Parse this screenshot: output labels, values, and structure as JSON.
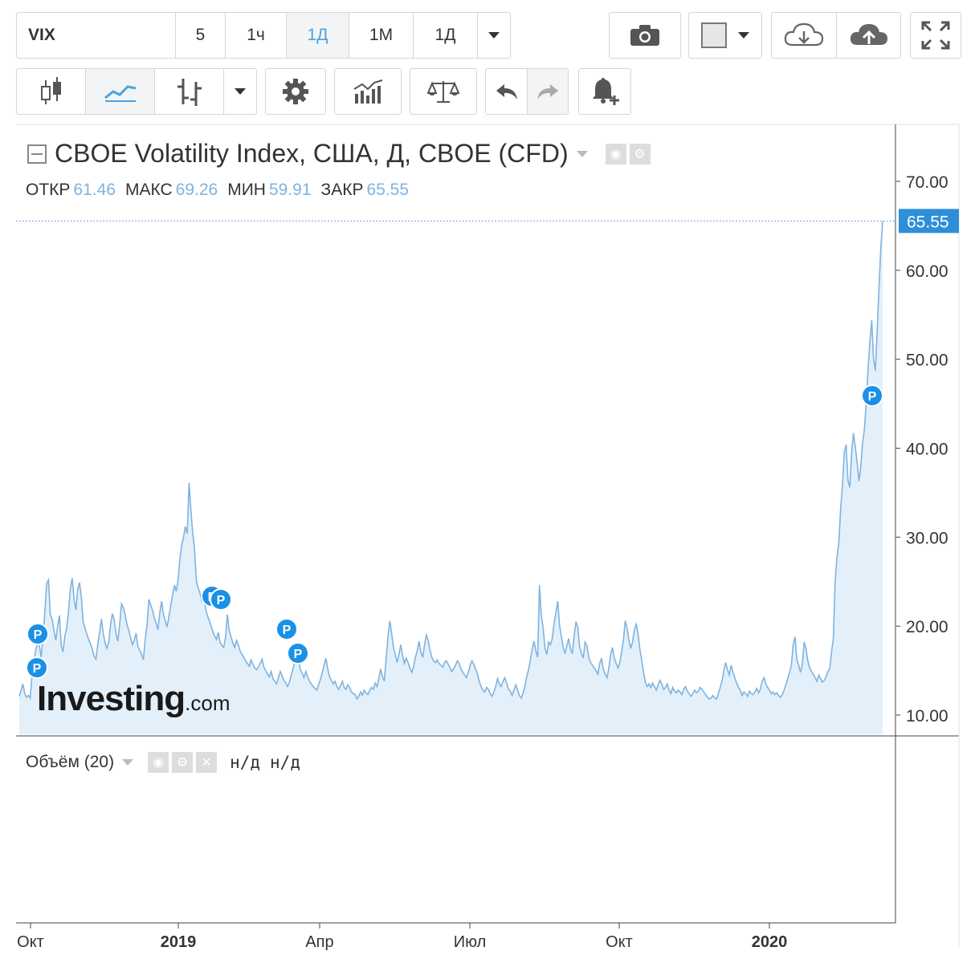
{
  "toolbar1": {
    "symbol": "VIX",
    "intervals": [
      "5",
      "1ч",
      "1Д",
      "1М",
      "1Д"
    ],
    "active_interval": "1Д"
  },
  "chart_header": {
    "title": "CBOE Volatility Index, США, Д, CBOE (CFD)",
    "open_label": "ОТКР",
    "open": "61.46",
    "high_label": "МАКС",
    "high": "69.26",
    "low_label": "МИН",
    "low": "59.91",
    "close_label": "ЗАКР",
    "close": "65.55"
  },
  "volume_panel": {
    "label": "Объём (20)",
    "value1": "н/д",
    "value2": "н/д"
  },
  "watermark": {
    "brand": "Investing",
    "suffix": ".com"
  },
  "colors": {
    "line": "#7fb3e0",
    "fill": "#e3f0fa",
    "accent": "#4aa3df",
    "price_tag": "#2e8fd9",
    "event": "#1a90e6"
  },
  "chart_data": {
    "type": "area",
    "title": "CBOE Volatility Index, США, Д, CBOE (CFD)",
    "y_ticks": [
      "10.00",
      "20.00",
      "30.00",
      "40.00",
      "50.00",
      "60.00",
      "70.00"
    ],
    "ylim": [
      8,
      75
    ],
    "x_ticks": [
      "Окт",
      "2019",
      "Апр",
      "Июл",
      "Окт",
      "2020"
    ],
    "last_price_label": "65.55",
    "last_value": 65.55,
    "event_marker_label": "P",
    "series": [
      {
        "values": [
          12.1,
          12.8,
          13.5,
          12.4,
          12.0,
          12.2,
          11.9,
          14.5,
          16.1,
          17.3,
          18.2,
          17.8,
          16.5,
          18.6,
          21.5,
          24.8,
          25.2,
          21.3,
          20.8,
          19.5,
          18.4,
          19.9,
          21.2,
          17.8,
          17.1,
          18.9,
          19.8,
          21.7,
          24.2,
          25.4,
          23.0,
          21.8,
          24.1,
          24.9,
          23.2,
          20.5,
          19.8,
          19.1,
          18.5,
          18.0,
          17.4,
          16.6,
          16.3,
          17.9,
          19.3,
          20.8,
          19.2,
          18.1,
          17.5,
          18.2,
          20.1,
          21.4,
          20.7,
          19.1,
          18.3,
          20.2,
          22.5,
          22.1,
          21.3,
          20.2,
          19.5,
          18.7,
          17.9,
          18.4,
          19.2,
          17.7,
          17.3,
          16.8,
          16.2,
          18.5,
          20.1,
          23.0,
          22.4,
          21.8,
          20.9,
          20.3,
          19.6,
          21.5,
          22.8,
          21.3,
          20.6,
          19.9,
          21.1,
          22.3,
          23.5,
          24.6,
          23.9,
          25.2,
          27.5,
          29.1,
          30.0,
          31.2,
          30.4,
          36.1,
          33.2,
          30.5,
          28.7,
          25.1,
          24.3,
          23.7,
          22.8,
          23.4,
          22.1,
          21.2,
          20.7,
          20.1,
          19.4,
          18.9,
          18.5,
          19.3,
          18.2,
          17.8,
          17.6,
          18.7,
          21.3,
          19.5,
          18.8,
          18.1,
          17.6,
          18.4,
          17.9,
          17.2,
          16.8,
          16.5,
          16.1,
          15.8,
          15.5,
          16.2,
          15.7,
          15.3,
          15.1,
          15.4,
          15.8,
          16.3,
          15.4,
          15.0,
          14.6,
          14.3,
          14.9,
          14.1,
          13.8,
          13.5,
          14.2,
          14.9,
          14.4,
          13.9,
          13.6,
          13.2,
          13.7,
          14.5,
          15.2,
          16.1,
          16.8,
          16.3,
          15.1,
          14.7,
          14.2,
          14.9,
          14.3,
          13.8,
          13.5,
          13.2,
          13.0,
          12.8,
          13.4,
          14.0,
          14.8,
          15.6,
          16.4,
          15.2,
          14.3,
          13.9,
          13.5,
          13.8,
          13.2,
          12.9,
          13.3,
          13.8,
          13.1,
          12.9,
          13.4,
          13.1,
          12.6,
          12.4,
          12.3,
          11.8,
          12.1,
          12.6,
          12.2,
          12.8,
          12.5,
          12.3,
          12.8,
          13.1,
          12.9,
          13.6,
          13.2,
          14.1,
          15.2,
          14.3,
          13.8,
          16.3,
          18.8,
          20.6,
          19.2,
          17.6,
          16.8,
          15.9,
          16.8,
          17.9,
          16.7,
          15.8,
          16.4,
          15.9,
          15.3,
          14.8,
          15.4,
          16.5,
          17.2,
          18.3,
          17.1,
          16.5,
          17.8,
          19.0,
          18.4,
          17.3,
          16.5,
          16.1,
          15.9,
          16.2,
          15.8,
          15.6,
          15.4,
          15.9,
          16.1,
          15.7,
          15.3,
          14.9,
          15.2,
          15.6,
          16.1,
          15.8,
          15.2,
          14.8,
          14.5,
          14.2,
          14.8,
          15.6,
          16.1,
          15.7,
          15.2,
          14.6,
          13.8,
          13.2,
          12.8,
          12.6,
          13.1,
          12.9,
          12.4,
          12.1,
          12.6,
          13.2,
          14.1,
          13.5,
          13.2,
          13.8,
          14.2,
          13.6,
          12.9,
          12.7,
          12.2,
          12.8,
          13.4,
          12.8,
          12.2,
          11.9,
          12.5,
          13.2,
          14.3,
          15.1,
          16.2,
          17.4,
          18.3,
          17.2,
          16.5,
          24.6,
          21.2,
          19.8,
          17.5,
          16.8,
          18.2,
          17.9,
          18.6,
          20.3,
          21.5,
          22.8,
          20.1,
          18.8,
          17.6,
          16.9,
          17.8,
          18.6,
          17.4,
          16.9,
          19.0,
          20.5,
          19.8,
          17.7,
          16.9,
          16.4,
          18.2,
          17.8,
          16.5,
          15.9,
          15.6,
          15.3,
          15.0,
          14.6,
          15.8,
          16.4,
          15.1,
          14.6,
          14.2,
          15.3,
          16.8,
          17.6,
          16.4,
          15.8,
          15.3,
          15.9,
          17.1,
          18.5,
          20.6,
          19.8,
          18.4,
          17.5,
          18.2,
          19.6,
          20.2,
          19.1,
          17.4,
          16.2,
          14.8,
          13.7,
          13.2,
          13.5,
          13.1,
          13.6,
          13.2,
          12.8,
          13.4,
          13.9,
          13.5,
          12.9,
          13.1,
          13.5,
          12.8,
          12.4,
          13.1,
          12.7,
          12.5,
          12.8,
          12.6,
          12.3,
          12.9,
          13.2,
          12.7,
          12.4,
          12.1,
          12.4,
          12.8,
          12.5,
          12.7,
          13.1,
          12.9,
          12.6,
          12.3,
          12.0,
          11.8,
          11.9,
          12.2,
          11.9,
          11.8,
          12.4,
          13.1,
          13.8,
          15.0,
          15.9,
          15.1,
          14.5,
          15.6,
          14.8,
          14.2,
          13.6,
          13.1,
          12.8,
          12.2,
          12.6,
          12.4,
          12.1,
          12.7,
          12.4,
          12.3,
          12.6,
          13.0,
          12.5,
          12.9,
          13.8,
          14.2,
          13.5,
          13.1,
          12.8,
          12.4,
          12.6,
          12.3,
          12.5,
          12.2,
          12.0,
          12.3,
          12.8,
          13.4,
          14.1,
          14.8,
          15.6,
          17.9,
          18.8,
          16.2,
          15.6,
          14.8,
          15.7,
          18.2,
          17.5,
          16.1,
          15.3,
          14.9,
          14.6,
          14.2,
          13.8,
          14.5,
          14.1,
          13.7,
          13.9,
          14.3,
          14.9,
          15.2,
          17.1,
          18.6,
          25.1,
          27.8,
          29.4,
          33.2,
          35.8,
          39.6,
          40.4,
          36.4,
          35.6,
          39.5,
          41.7,
          40.2,
          38.4,
          36.3,
          37.9,
          40.6,
          42.1,
          45.0,
          48.9,
          52.0,
          54.4,
          50.1,
          48.7,
          53.1,
          58.2,
          62.4,
          65.55
        ]
      }
    ]
  }
}
